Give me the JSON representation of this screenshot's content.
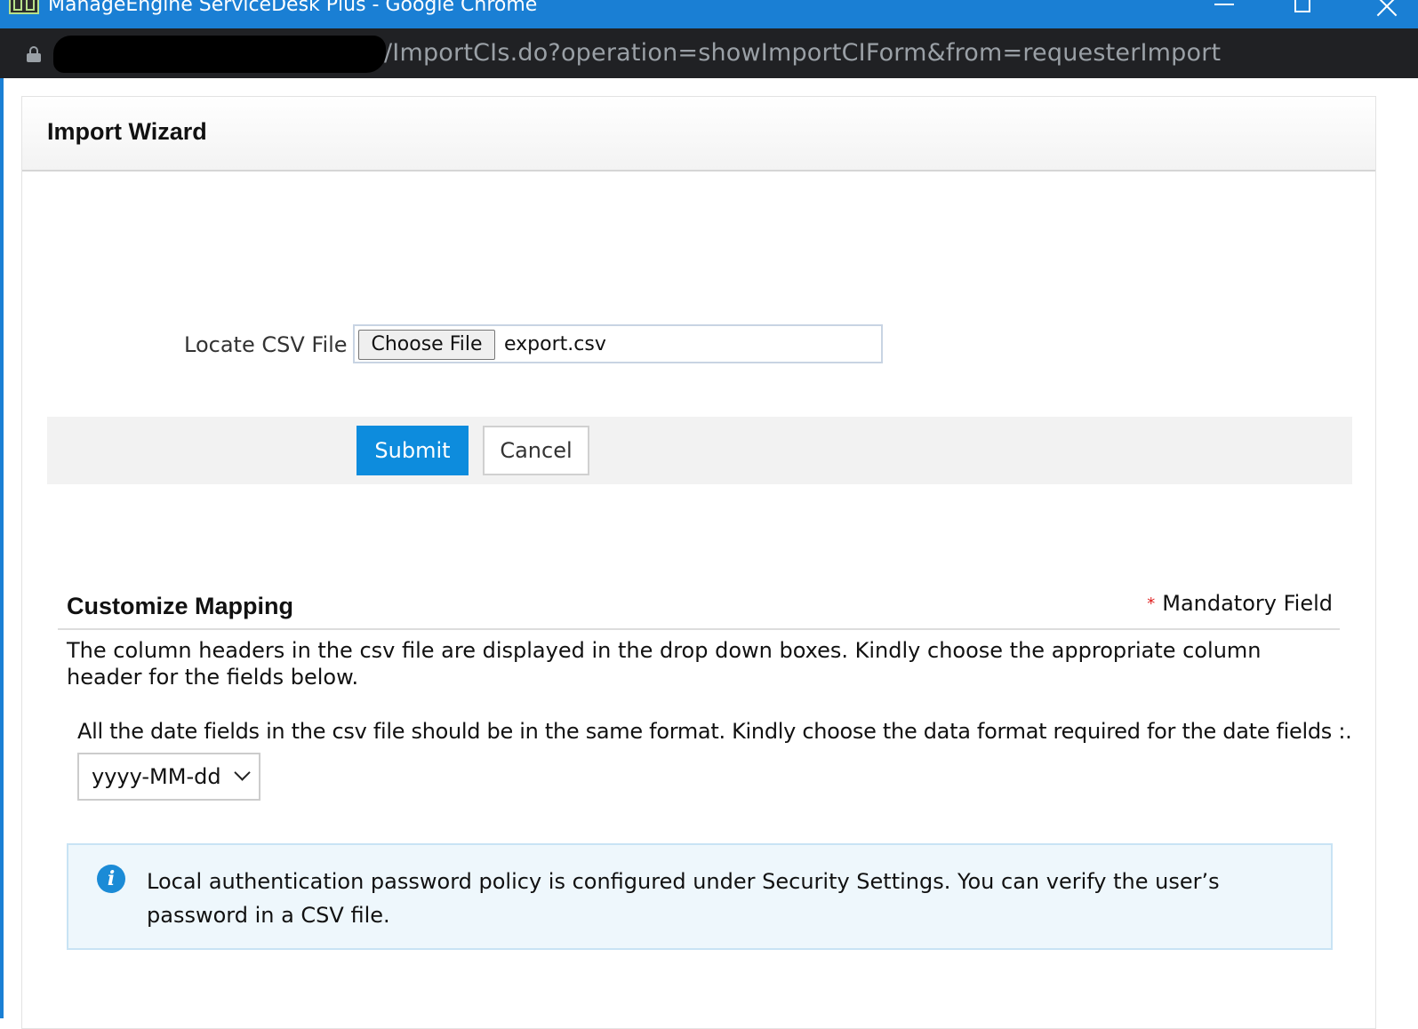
{
  "window": {
    "title": "ManageEngine ServiceDesk Plus - Google Chrome"
  },
  "browser": {
    "url": "/ImportCIs.do?operation=showImportCIForm&from=requesterImport"
  },
  "wizard": {
    "title": "Import Wizard",
    "csv_label": "Locate CSV File",
    "choose_file_label": "Choose File",
    "file_name": "export.csv",
    "submit_label": "Submit",
    "cancel_label": "Cancel"
  },
  "mapping": {
    "title": "Customize Mapping",
    "mandatory_star": "*",
    "mandatory_label": "Mandatory Field",
    "description": " The column headers in the csv file are displayed in the drop down boxes. Kindly choose the appropriate column header for the fields below.",
    "date_instruction": "All the date fields in the csv file should be in the same format. Kindly choose the data format required for the date fields :.",
    "date_format_value": "yyyy-MM-dd"
  },
  "info": {
    "icon_glyph": "i",
    "message": "Local authentication password policy is configured under Security Settings. You can verify the user’s password in a CSV file."
  },
  "colors": {
    "titlebar": "#1a7fd4",
    "submit": "#0d8cdd",
    "info_bg": "#eef7fc"
  }
}
